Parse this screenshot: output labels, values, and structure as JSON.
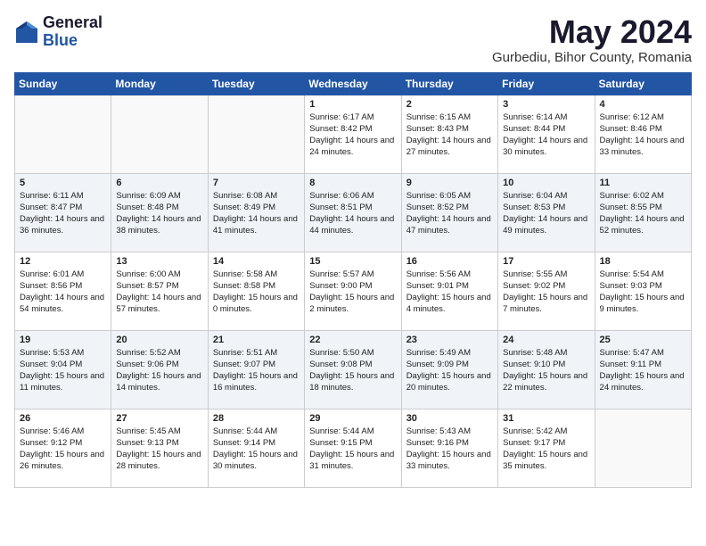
{
  "logo": {
    "general": "General",
    "blue": "Blue"
  },
  "title": "May 2024",
  "location": "Gurbediu, Bihor County, Romania",
  "days_of_week": [
    "Sunday",
    "Monday",
    "Tuesday",
    "Wednesday",
    "Thursday",
    "Friday",
    "Saturday"
  ],
  "weeks": [
    [
      {
        "day": "",
        "info": ""
      },
      {
        "day": "",
        "info": ""
      },
      {
        "day": "",
        "info": ""
      },
      {
        "day": "1",
        "info": "Sunrise: 6:17 AM\nSunset: 8:42 PM\nDaylight: 14 hours\nand 24 minutes."
      },
      {
        "day": "2",
        "info": "Sunrise: 6:15 AM\nSunset: 8:43 PM\nDaylight: 14 hours\nand 27 minutes."
      },
      {
        "day": "3",
        "info": "Sunrise: 6:14 AM\nSunset: 8:44 PM\nDaylight: 14 hours\nand 30 minutes."
      },
      {
        "day": "4",
        "info": "Sunrise: 6:12 AM\nSunset: 8:46 PM\nDaylight: 14 hours\nand 33 minutes."
      }
    ],
    [
      {
        "day": "5",
        "info": "Sunrise: 6:11 AM\nSunset: 8:47 PM\nDaylight: 14 hours\nand 36 minutes."
      },
      {
        "day": "6",
        "info": "Sunrise: 6:09 AM\nSunset: 8:48 PM\nDaylight: 14 hours\nand 38 minutes."
      },
      {
        "day": "7",
        "info": "Sunrise: 6:08 AM\nSunset: 8:49 PM\nDaylight: 14 hours\nand 41 minutes."
      },
      {
        "day": "8",
        "info": "Sunrise: 6:06 AM\nSunset: 8:51 PM\nDaylight: 14 hours\nand 44 minutes."
      },
      {
        "day": "9",
        "info": "Sunrise: 6:05 AM\nSunset: 8:52 PM\nDaylight: 14 hours\nand 47 minutes."
      },
      {
        "day": "10",
        "info": "Sunrise: 6:04 AM\nSunset: 8:53 PM\nDaylight: 14 hours\nand 49 minutes."
      },
      {
        "day": "11",
        "info": "Sunrise: 6:02 AM\nSunset: 8:55 PM\nDaylight: 14 hours\nand 52 minutes."
      }
    ],
    [
      {
        "day": "12",
        "info": "Sunrise: 6:01 AM\nSunset: 8:56 PM\nDaylight: 14 hours\nand 54 minutes."
      },
      {
        "day": "13",
        "info": "Sunrise: 6:00 AM\nSunset: 8:57 PM\nDaylight: 14 hours\nand 57 minutes."
      },
      {
        "day": "14",
        "info": "Sunrise: 5:58 AM\nSunset: 8:58 PM\nDaylight: 15 hours\nand 0 minutes."
      },
      {
        "day": "15",
        "info": "Sunrise: 5:57 AM\nSunset: 9:00 PM\nDaylight: 15 hours\nand 2 minutes."
      },
      {
        "day": "16",
        "info": "Sunrise: 5:56 AM\nSunset: 9:01 PM\nDaylight: 15 hours\nand 4 minutes."
      },
      {
        "day": "17",
        "info": "Sunrise: 5:55 AM\nSunset: 9:02 PM\nDaylight: 15 hours\nand 7 minutes."
      },
      {
        "day": "18",
        "info": "Sunrise: 5:54 AM\nSunset: 9:03 PM\nDaylight: 15 hours\nand 9 minutes."
      }
    ],
    [
      {
        "day": "19",
        "info": "Sunrise: 5:53 AM\nSunset: 9:04 PM\nDaylight: 15 hours\nand 11 minutes."
      },
      {
        "day": "20",
        "info": "Sunrise: 5:52 AM\nSunset: 9:06 PM\nDaylight: 15 hours\nand 14 minutes."
      },
      {
        "day": "21",
        "info": "Sunrise: 5:51 AM\nSunset: 9:07 PM\nDaylight: 15 hours\nand 16 minutes."
      },
      {
        "day": "22",
        "info": "Sunrise: 5:50 AM\nSunset: 9:08 PM\nDaylight: 15 hours\nand 18 minutes."
      },
      {
        "day": "23",
        "info": "Sunrise: 5:49 AM\nSunset: 9:09 PM\nDaylight: 15 hours\nand 20 minutes."
      },
      {
        "day": "24",
        "info": "Sunrise: 5:48 AM\nSunset: 9:10 PM\nDaylight: 15 hours\nand 22 minutes."
      },
      {
        "day": "25",
        "info": "Sunrise: 5:47 AM\nSunset: 9:11 PM\nDaylight: 15 hours\nand 24 minutes."
      }
    ],
    [
      {
        "day": "26",
        "info": "Sunrise: 5:46 AM\nSunset: 9:12 PM\nDaylight: 15 hours\nand 26 minutes."
      },
      {
        "day": "27",
        "info": "Sunrise: 5:45 AM\nSunset: 9:13 PM\nDaylight: 15 hours\nand 28 minutes."
      },
      {
        "day": "28",
        "info": "Sunrise: 5:44 AM\nSunset: 9:14 PM\nDaylight: 15 hours\nand 30 minutes."
      },
      {
        "day": "29",
        "info": "Sunrise: 5:44 AM\nSunset: 9:15 PM\nDaylight: 15 hours\nand 31 minutes."
      },
      {
        "day": "30",
        "info": "Sunrise: 5:43 AM\nSunset: 9:16 PM\nDaylight: 15 hours\nand 33 minutes."
      },
      {
        "day": "31",
        "info": "Sunrise: 5:42 AM\nSunset: 9:17 PM\nDaylight: 15 hours\nand 35 minutes."
      },
      {
        "day": "",
        "info": ""
      }
    ]
  ]
}
